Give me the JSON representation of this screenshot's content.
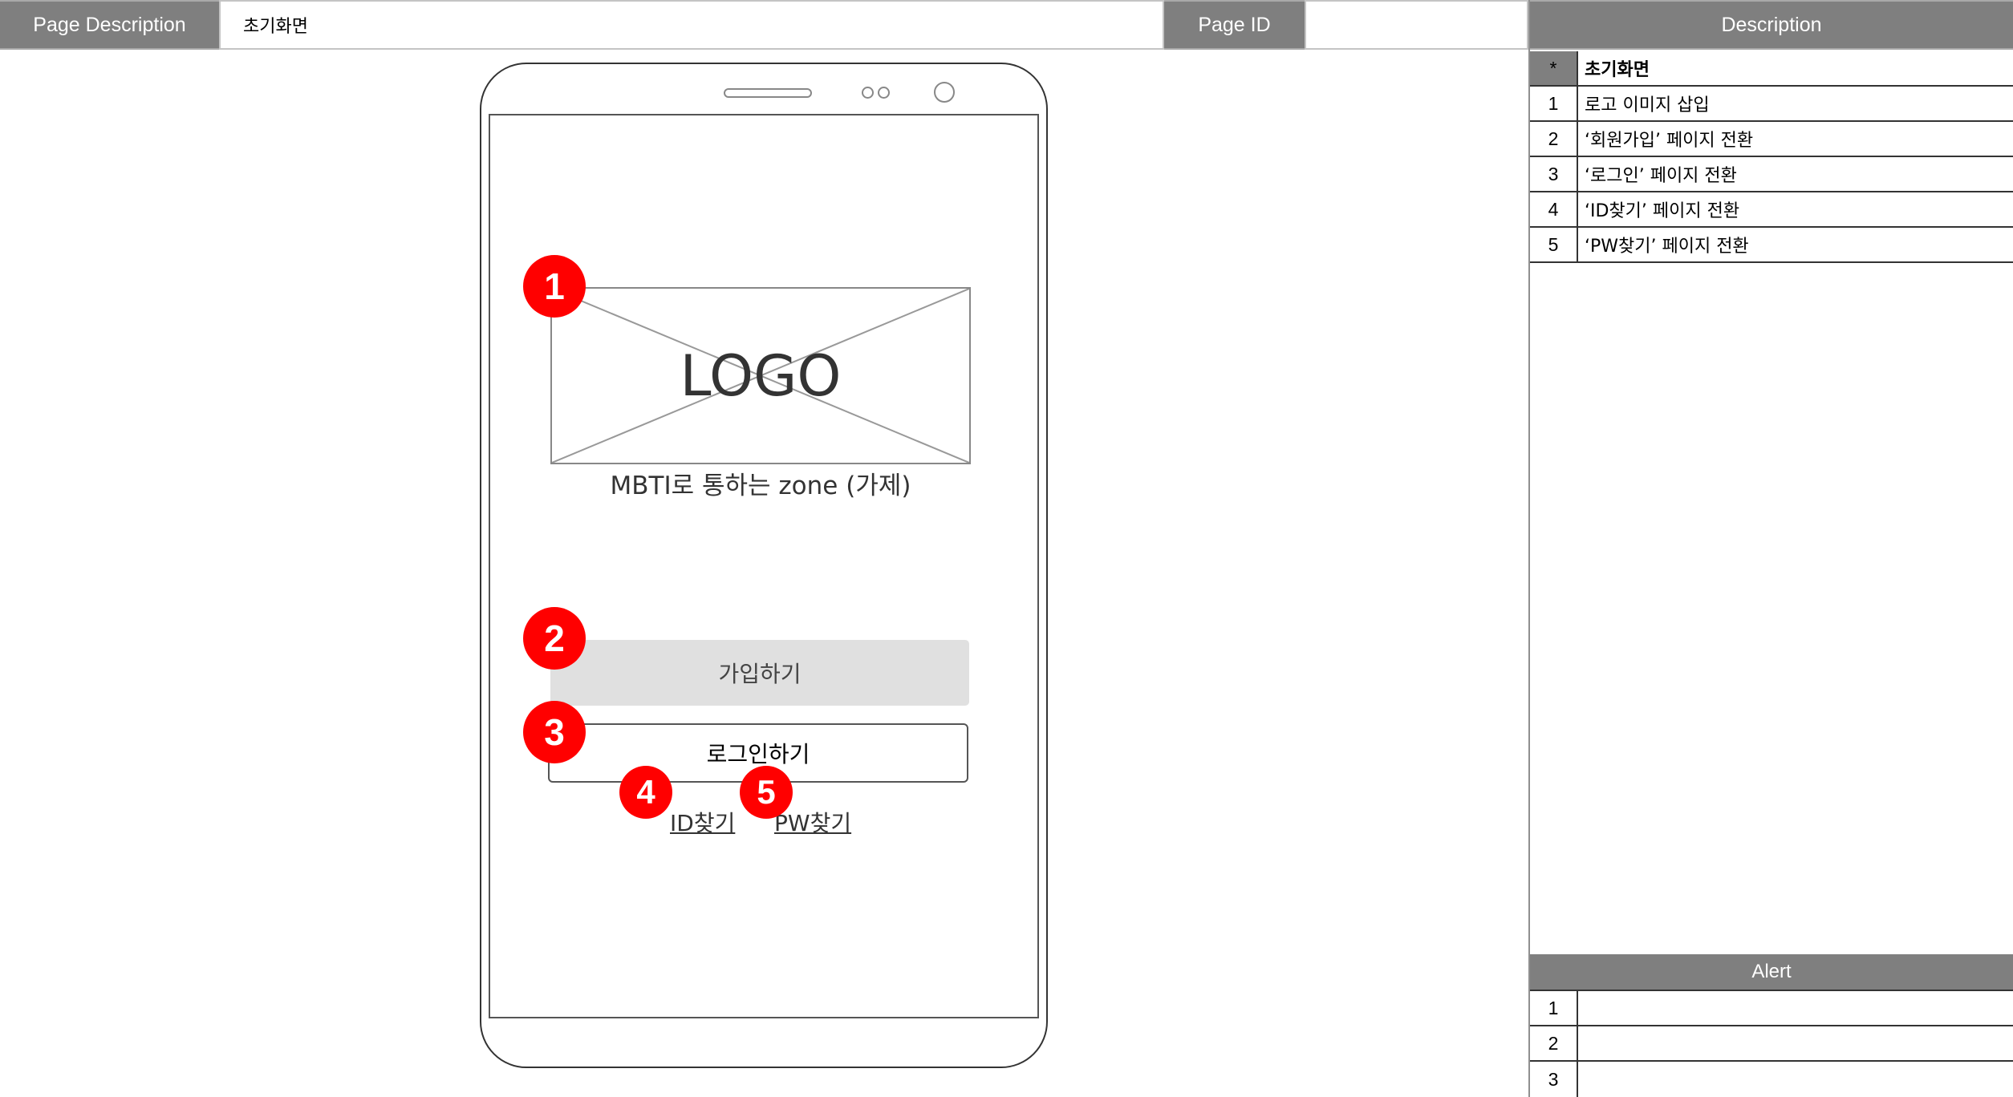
{
  "header": {
    "page_description_label": "Page Description",
    "page_description_value": "초기화면",
    "page_id_label": "Page ID",
    "page_id_value": "",
    "description_label": "Description"
  },
  "description_table": {
    "head": {
      "num": "*",
      "text": "초기화면"
    },
    "rows": [
      {
        "num": "1",
        "text": "로고 이미지 삽입"
      },
      {
        "num": "2",
        "text": "‘회원가입’ 페이지 전환"
      },
      {
        "num": "3",
        "text": "‘로그인’ 페이지 전환"
      },
      {
        "num": "4",
        "text": "‘ID찾기’ 페이지 전환"
      },
      {
        "num": "5",
        "text": "‘PW찾기’ 페이지 전환"
      }
    ]
  },
  "alert_table": {
    "title": "Alert",
    "rows": [
      {
        "num": "1",
        "text": ""
      },
      {
        "num": "2",
        "text": ""
      },
      {
        "num": "3",
        "text": ""
      }
    ]
  },
  "screen": {
    "logo_text": "LOGO",
    "tagline": "MBTI로 통하는 zone (가제)",
    "signup_button": "가입하기",
    "login_button": "로그인하기",
    "find_id_link": "ID찾기",
    "find_pw_link": "PW찾기"
  },
  "markers": [
    "1",
    "2",
    "3",
    "4",
    "5"
  ],
  "colors": {
    "header_gray": "#7f7f7f",
    "marker_red": "#ff0000",
    "signup_button_bg": "#e0e0e0"
  }
}
